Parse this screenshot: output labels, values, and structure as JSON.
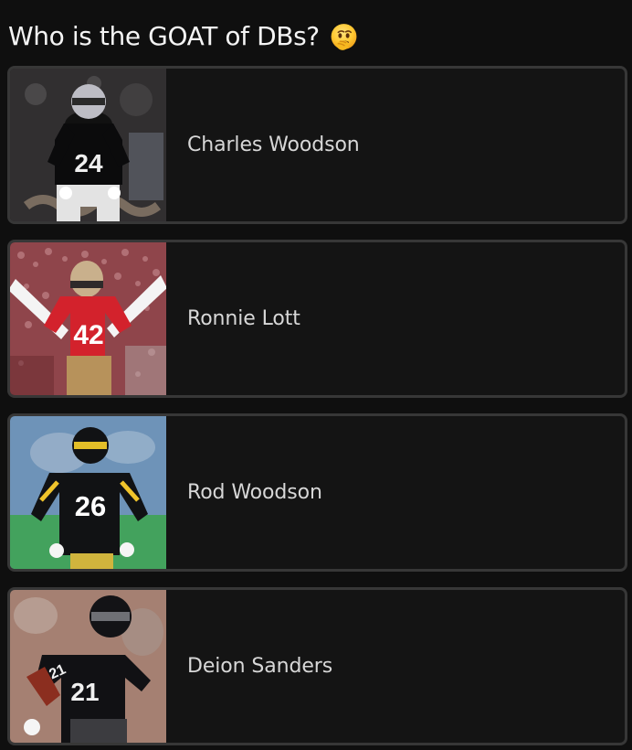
{
  "poll": {
    "title": "Who is the GOAT of DBs?",
    "title_icon": "thinking-face-emoji",
    "options": [
      {
        "label": "Charles Woodson",
        "image_icon": "player-photo",
        "jersey_number": "24"
      },
      {
        "label": "Ronnie Lott",
        "image_icon": "player-photo",
        "jersey_number": "42"
      },
      {
        "label": "Rod Woodson",
        "image_icon": "player-photo",
        "jersey_number": "26"
      },
      {
        "label": "Deion Sanders",
        "image_icon": "player-photo",
        "jersey_number": "21"
      }
    ]
  },
  "colors": {
    "background": "#0f0f0f",
    "card": "#141414",
    "border": "#373737",
    "title_text": "#f4f4f4",
    "option_text": "#d7d7d7"
  }
}
